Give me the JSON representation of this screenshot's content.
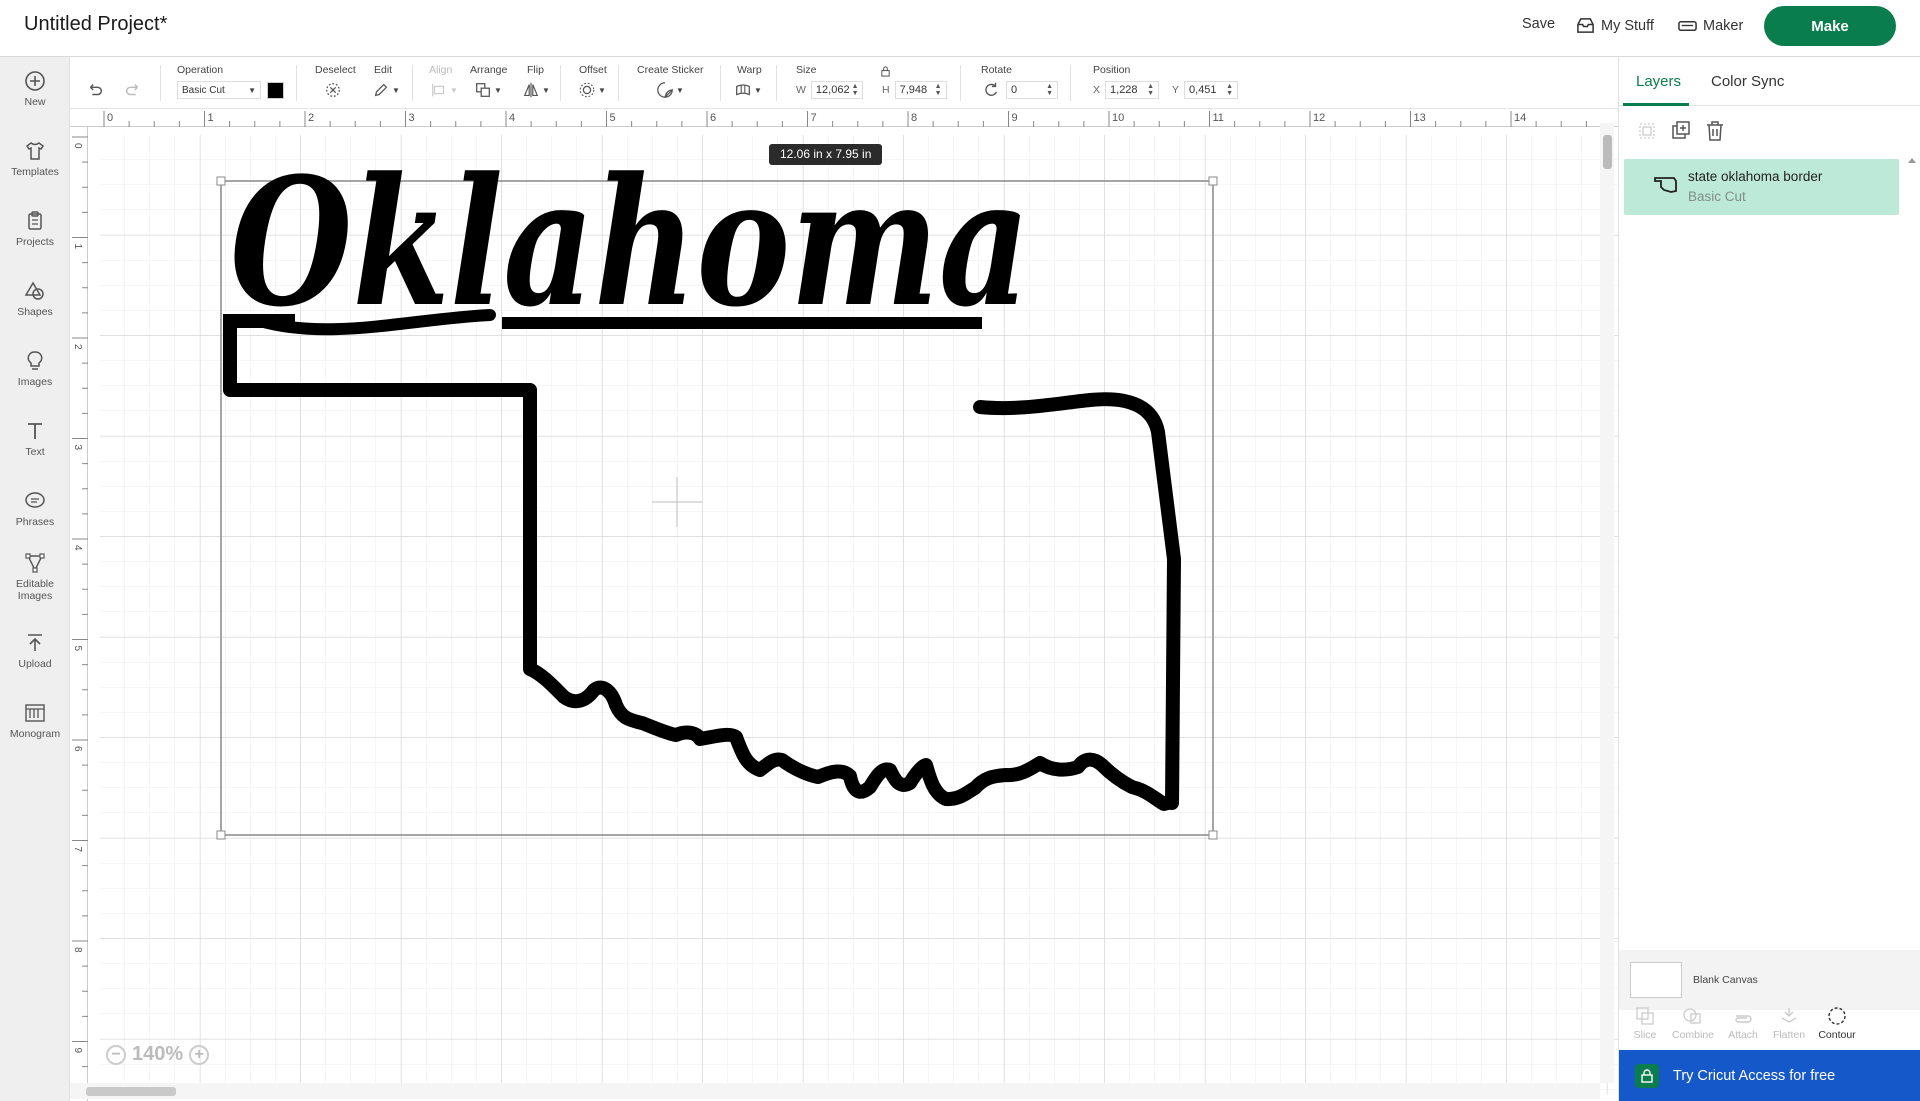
{
  "header": {
    "title": "Untitled Project*",
    "save_label": "Save",
    "mystuff_label": "My Stuff",
    "maker_label": "Maker",
    "make_label": "Make"
  },
  "sidebar": {
    "items": [
      {
        "label": "New",
        "icon": "plus-circle-icon"
      },
      {
        "label": "Templates",
        "icon": "tshirt-icon"
      },
      {
        "label": "Projects",
        "icon": "clipboard-icon"
      },
      {
        "label": "Shapes",
        "icon": "shapes-icon"
      },
      {
        "label": "Images",
        "icon": "lightbulb-icon"
      },
      {
        "label": "Text",
        "icon": "text-icon"
      },
      {
        "label": "Phrases",
        "icon": "speech-bubble-icon"
      },
      {
        "label": "Editable",
        "label2": "Images",
        "icon": "editable-images-icon"
      },
      {
        "label": "Upload",
        "icon": "upload-icon"
      },
      {
        "label": "Monogram",
        "icon": "monogram-icon"
      }
    ]
  },
  "toolbar": {
    "operation_label": "Operation",
    "operation_value": "Basic Cut",
    "operation_color": "#000000",
    "deselect_label": "Deselect",
    "edit_label": "Edit",
    "align_label": "Align",
    "arrange_label": "Arrange",
    "flip_label": "Flip",
    "offset_label": "Offset",
    "create_sticker_label": "Create Sticker",
    "warp_label": "Warp",
    "size_label": "Size",
    "w_label": "W",
    "w_value": "12,062",
    "h_label": "H",
    "h_value": "7,948",
    "rotate_label": "Rotate",
    "rotate_value": "0",
    "position_label": "Position",
    "x_label": "X",
    "x_value": "1,228",
    "y_label": "Y",
    "y_value": "0,451"
  },
  "canvas": {
    "size_tooltip": "12.06  in x 7.95  in",
    "zoom_value": "140%",
    "ruler_top": [
      "0",
      "1",
      "2",
      "3",
      "4",
      "5",
      "6",
      "7",
      "8",
      "9",
      "10",
      "11",
      "12",
      "13",
      "14"
    ],
    "ruler_left": [
      "0",
      "1",
      "2",
      "3",
      "4",
      "5",
      "6",
      "7",
      "8",
      "9"
    ],
    "design_text": "Oklahoma"
  },
  "right_panel": {
    "tabs": [
      "Layers",
      "Color Sync"
    ],
    "layer": {
      "name": "state oklahoma border",
      "operation": "Basic Cut"
    },
    "blank_canvas_label": "Blank Canvas",
    "bottom_tools": [
      "Slice",
      "Combine",
      "Attach",
      "Flatten",
      "Contour"
    ],
    "access_label": "Try Cricut Access for free"
  },
  "colors": {
    "brand_green": "#0a7d4e",
    "layer_highlight": "#bde9d8",
    "access_blue": "#1558c9"
  }
}
